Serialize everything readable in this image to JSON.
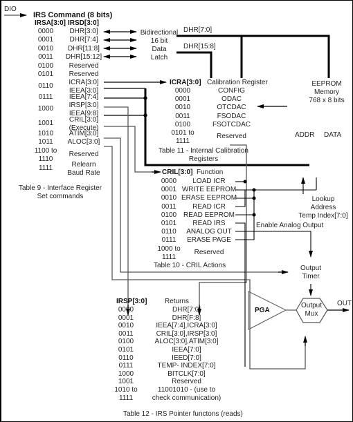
{
  "dio_label": "DIO",
  "irs_command": {
    "title": "IRS Command (8 bits)",
    "col_addr": "IRSA[3:0]",
    "col_data": "IRSD[3:0]",
    "rows": [
      {
        "addr": "0000",
        "data": "DHR[3:0]"
      },
      {
        "addr": "0001",
        "data": "DHR[7:4]"
      },
      {
        "addr": "0010",
        "data": "DHR[11:8]"
      },
      {
        "addr": "0011",
        "data": "DHR[15:12]"
      },
      {
        "addr": "0100",
        "data": "Reserved"
      },
      {
        "addr": "0101",
        "data": "Reserved"
      },
      {
        "addr": "0110",
        "data": "ICRA[3:0]",
        "data2": "IEEA[3:0]"
      },
      {
        "addr": "0111",
        "data": "IEEA[7:4]"
      },
      {
        "addr": "1000",
        "data": "IRSP[3:0]",
        "data2": "IEEA[9:8]"
      },
      {
        "addr": "1001",
        "data": "CRIL[3:0]",
        "data2": "(Execute)"
      },
      {
        "addr": "1010",
        "data": "ATIM[3:0]"
      },
      {
        "addr": "1011",
        "data": "ALOC[3:0]"
      },
      {
        "addr": "1100 to",
        "addr2": "1110",
        "data": "Reserved"
      },
      {
        "addr": "1111",
        "data": "Relearn",
        "data2": "Baud Rate"
      }
    ],
    "caption_line1": "Table 9  -  Interface Register",
    "caption_line2": "Set commands"
  },
  "latch": {
    "line1": "Bidirectional",
    "line2": "16 bit",
    "line3": "Data",
    "line4": "Latch"
  },
  "bus_labels": {
    "dhr_low": "DHR[7:0]",
    "dhr_high": "DHR[15:8]"
  },
  "eeprom": {
    "line1": "EEPROM",
    "line2": "Memory",
    "line3": "768 x 8 bits",
    "addr": "ADDR",
    "data": "DATA"
  },
  "calibration": {
    "col_addr": "ICRA[3:0]",
    "col_name": "Calibration Register",
    "rows": [
      {
        "addr": "0000",
        "name": "CONFIG"
      },
      {
        "addr": "0001",
        "name": "ODAC"
      },
      {
        "addr": "0010",
        "name": "OTCDAC"
      },
      {
        "addr": "0011",
        "name": "FSODAC"
      },
      {
        "addr": "0100",
        "name": "FSOTCDAC"
      },
      {
        "addr": "0101 to",
        "addr2": "1111",
        "name": "Reserved"
      }
    ],
    "caption_line1": "Table 11 -  Internal Calibration",
    "caption_line2": "Registers"
  },
  "cril": {
    "col_addr": "CRIL[3:0]",
    "col_name": "Function",
    "rows": [
      {
        "addr": "0000",
        "name": "LOAD ICR"
      },
      {
        "addr": "0001",
        "name": "WRITE EEPROM"
      },
      {
        "addr": "0010",
        "name": "ERASE EEPROM"
      },
      {
        "addr": "0011",
        "name": "READ ICR"
      },
      {
        "addr": "0100",
        "name": "READ EEPROM"
      },
      {
        "addr": "0101",
        "name": "READ IRS"
      },
      {
        "addr": "0110",
        "name": "ANALOG OUT"
      },
      {
        "addr": "0111",
        "name": "ERASE PAGE"
      },
      {
        "addr": "1000 to",
        "addr2": "1111",
        "name": "Reserved"
      }
    ],
    "caption": "Table 10 - CRIL Actions"
  },
  "lookup": {
    "line1": "Lookup",
    "line2": "Address",
    "line3": "Temp Index[7:0]"
  },
  "enable_analog": "Enable Analog Output",
  "output_timer": {
    "line1": "Output",
    "line2": "Timer"
  },
  "pga": "PGA",
  "mux": {
    "line1": "Output",
    "line2": "Mux"
  },
  "out": "OUT",
  "irsp": {
    "col_addr": "IRSP[3:0]",
    "col_name": "Returns",
    "rows": [
      {
        "addr": "0000",
        "name": "DHR[7:0]"
      },
      {
        "addr": "0001",
        "name": "DHR[F:8]"
      },
      {
        "addr": "0010",
        "name": "IEEA[7:4],ICRA[3:0]"
      },
      {
        "addr": "0011",
        "name": "CRIL[3:0],IRSP[3:0]"
      },
      {
        "addr": "0100",
        "name": "ALOC[3:0],ATIM[3:0]"
      },
      {
        "addr": "0101",
        "name": "IEEA[7:0]"
      },
      {
        "addr": "0110",
        "name": "IEED[7:0]"
      },
      {
        "addr": "0111",
        "name": "TEMP- INDEX[7:0]"
      },
      {
        "addr": "1000",
        "name": "BITCLK[7:0]"
      },
      {
        "addr": "1001",
        "name": "Reserved"
      },
      {
        "addr": "1010 to",
        "addr2": "1111",
        "name": "11001010 - (use to",
        "name2": "check communication)"
      }
    ],
    "caption": "Table 12 - IRS Pointer functons (reads)"
  }
}
